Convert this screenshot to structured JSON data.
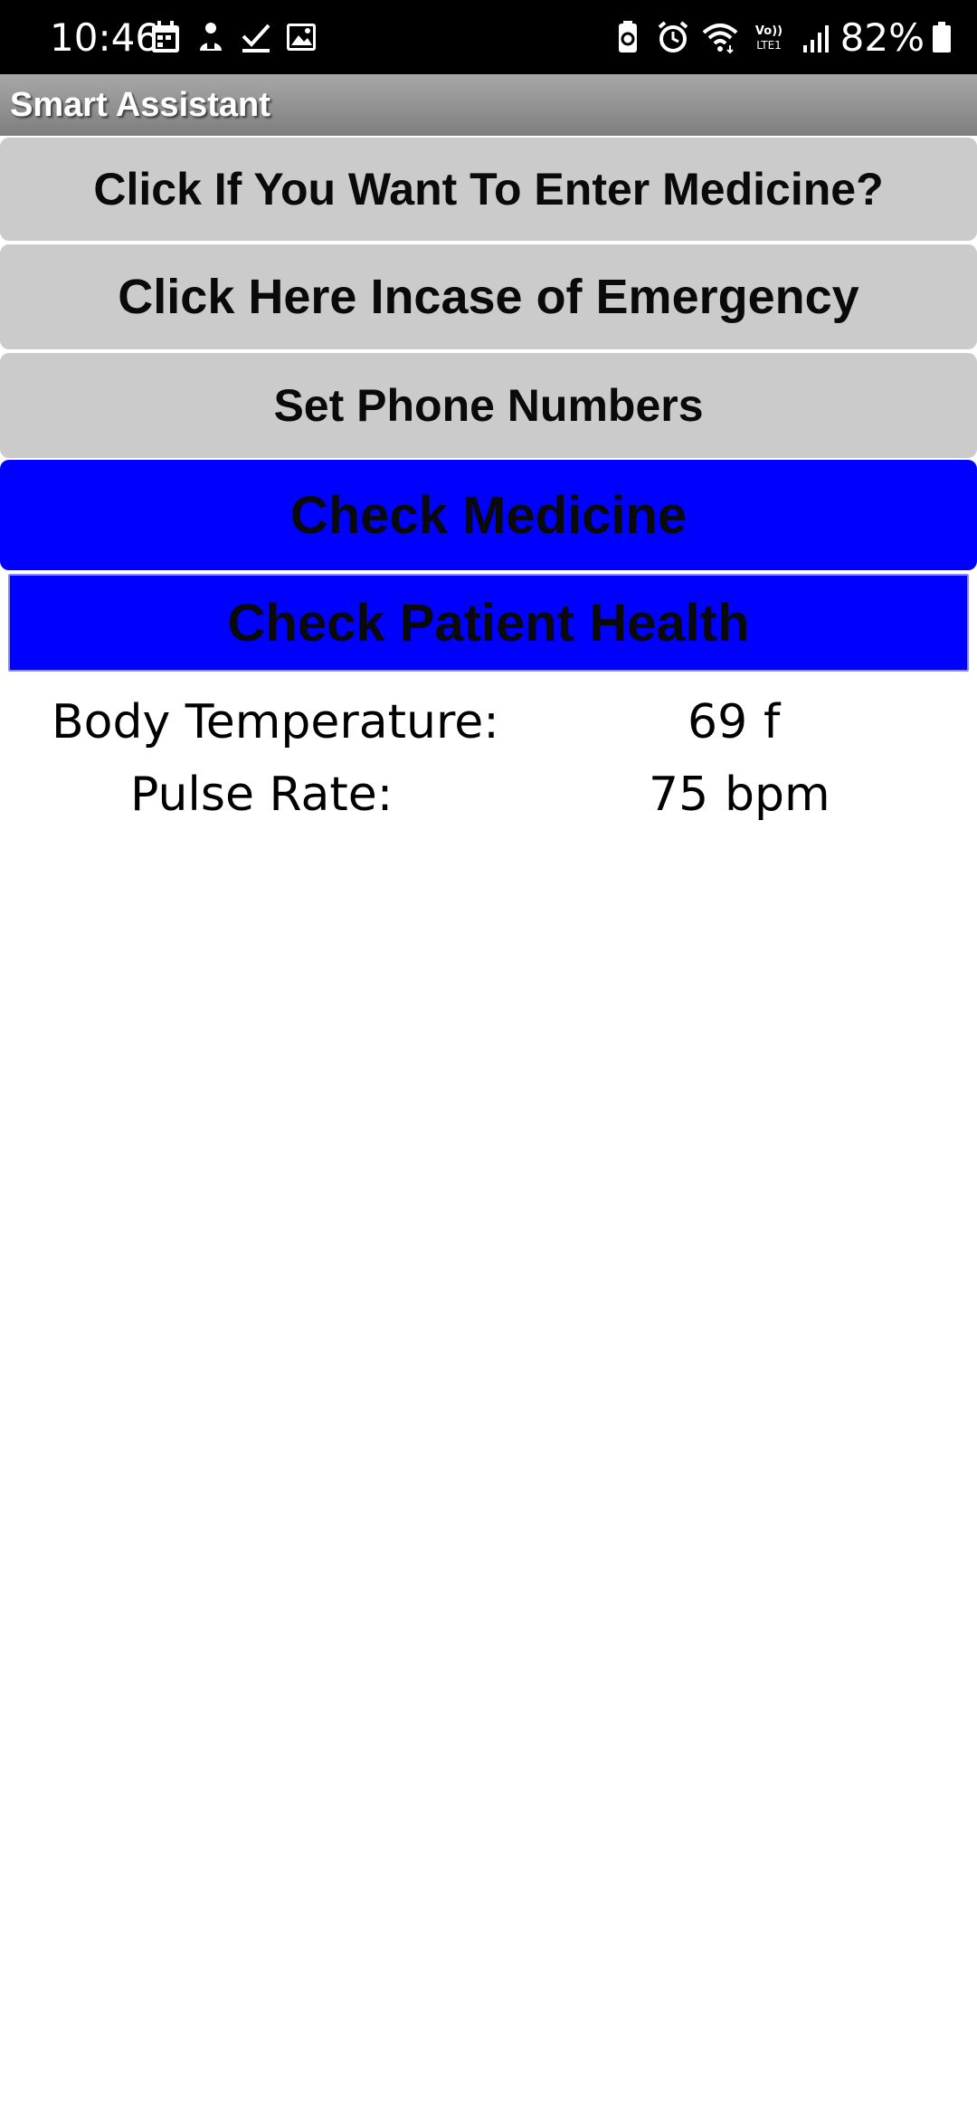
{
  "status_bar": {
    "time": "10:46",
    "battery_percent": "82%",
    "left_icons": [
      "calendar-icon",
      "person-icon",
      "checkmark-icon",
      "image-icon"
    ],
    "right_icons": [
      "battery-saver-icon",
      "alarm-icon",
      "wifi-icon",
      "volte-icon",
      "signal-icon"
    ],
    "volte_label": "Vo)) LTE1"
  },
  "app": {
    "title": "Smart Assistant"
  },
  "buttons": {
    "enter_medicine": "Click If You Want To Enter Medicine?",
    "emergency": "Click Here Incase of Emergency",
    "set_phone": "Set Phone Numbers",
    "check_medicine": "Check Medicine",
    "check_health": "Check Patient Health"
  },
  "health": {
    "temperature_label": "Body Temperature:",
    "temperature_value": "69",
    "temperature_unit": "f",
    "pulse_label": "Pulse Rate:",
    "pulse_value": "75",
    "pulse_unit": "bpm"
  },
  "colors": {
    "status_bar": "#000000",
    "title_bar": "#8f8f8f",
    "gray_button": "#cbcbcb",
    "blue_button": "#0000ff"
  }
}
